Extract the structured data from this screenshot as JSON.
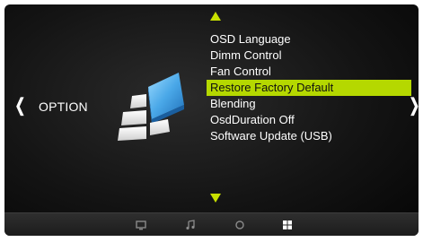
{
  "section": {
    "title": "OPTION",
    "prev_glyph": "❮",
    "next_glyph": "❯"
  },
  "menu": {
    "items": [
      {
        "label": "OSD Language",
        "selected": false
      },
      {
        "label": "Dimm Control",
        "selected": false
      },
      {
        "label": "Fan Control",
        "selected": false
      },
      {
        "label": "Restore Factory Default",
        "selected": true
      },
      {
        "label": "Blending",
        "selected": false
      },
      {
        "label": "OsdDuration Off",
        "selected": false
      },
      {
        "label": "Software Update (USB)",
        "selected": false
      }
    ],
    "highlight_color": "#b5d800",
    "arrow_color": "#c8e000"
  },
  "taskbar": {
    "icons": [
      "picture-icon",
      "music-icon",
      "circle-icon",
      "option-grid-icon"
    ],
    "active": "option-grid-icon"
  },
  "colors": {
    "background": "#141414",
    "text": "#ffffff",
    "icon_blue": "#4aa8e8"
  }
}
